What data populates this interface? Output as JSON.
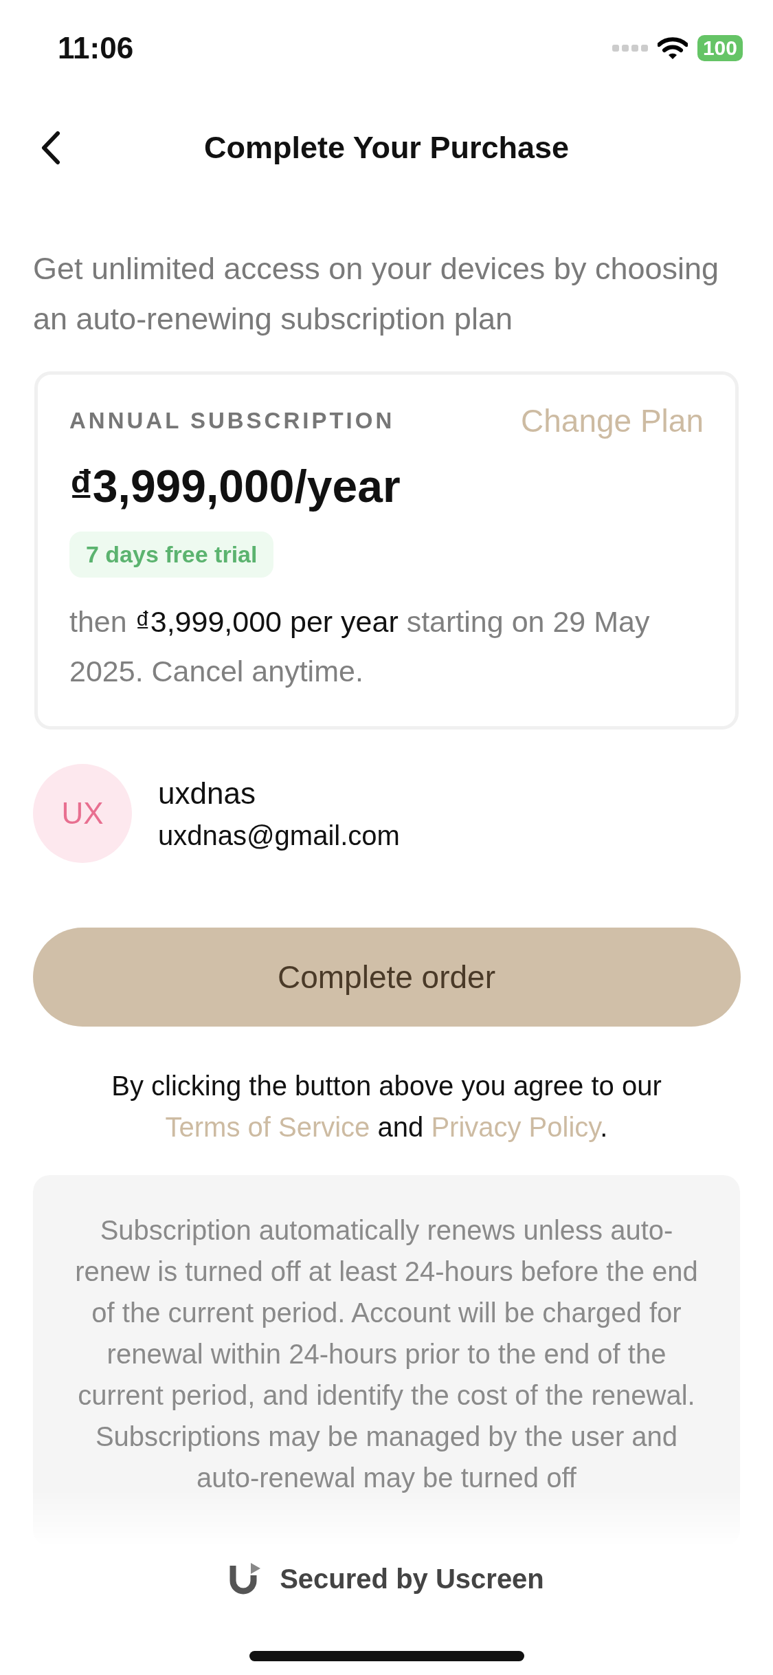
{
  "status_bar": {
    "time": "11:06",
    "battery": "100"
  },
  "nav": {
    "title": "Complete Your Purchase"
  },
  "intro": "Get unlimited access on your devices by choosing an auto-renewing subscription plan",
  "plan": {
    "label": "ANNUAL SUBSCRIPTION",
    "change_link": "Change Plan",
    "price": "₫3,999,000/year",
    "badge": "7 days free trial",
    "terms_before": "then",
    "terms_amount": "₫3,999,000 per year",
    "terms_after": "starting on 29 May 2025. Cancel anytime."
  },
  "account": {
    "initials": "UX",
    "name": "uxdnas",
    "email": "uxdnas@gmail.com"
  },
  "order_button": "Complete order",
  "agreement": {
    "before": "By clicking the button above you agree to our",
    "link_1": "Terms of Service",
    "middle": "and",
    "link_2": "Privacy Policy",
    "after": "."
  },
  "fine_print": "Subscription automatically renews unless auto-renew is turned off at least 24-hours before the end of the current period. Account will be charged for renewal within 24-hours prior to the end of the current period, and identify the cost of the renewal. Subscriptions may be managed by the user and auto-renewal may be turned off",
  "footer": "Secured by Uscreen"
}
